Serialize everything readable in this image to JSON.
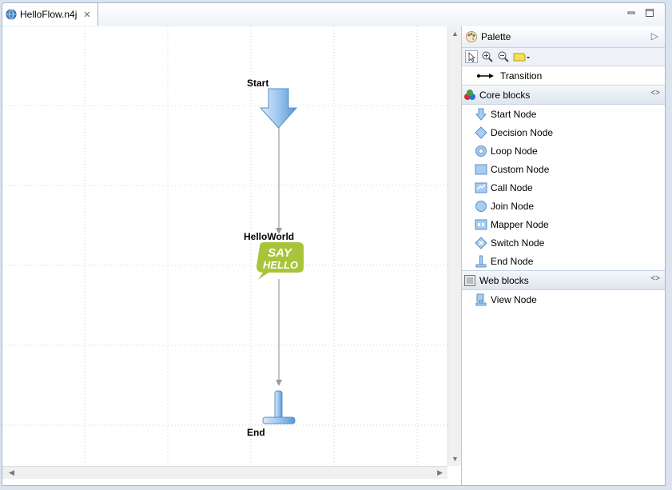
{
  "editor": {
    "tab_title": "HelloFlow.n4j",
    "tab_close_icon": "close-icon",
    "minimize_icon": "minimize-icon",
    "maximize_icon": "maximize-icon"
  },
  "flow": {
    "start_label": "Start",
    "hello_label": "HelloWorld",
    "end_label": "End",
    "say_hello_text": [
      "SAY",
      "HELLO"
    ]
  },
  "palette": {
    "title": "Palette",
    "transition_label": "Transition",
    "core_drawer_label": "Core blocks",
    "core_items": [
      {
        "label": "Start Node",
        "icon": "start-node-icon"
      },
      {
        "label": "Decision Node",
        "icon": "decision-node-icon"
      },
      {
        "label": "Loop Node",
        "icon": "loop-node-icon"
      },
      {
        "label": "Custom Node",
        "icon": "custom-node-icon"
      },
      {
        "label": "Call Node",
        "icon": "call-node-icon"
      },
      {
        "label": "Join Node",
        "icon": "join-node-icon"
      },
      {
        "label": "Mapper Node",
        "icon": "mapper-node-icon"
      },
      {
        "label": "Switch Node",
        "icon": "switch-node-icon"
      },
      {
        "label": "End Node",
        "icon": "end-node-icon"
      }
    ],
    "web_drawer_label": "Web blocks",
    "web_items": [
      {
        "label": "View Node",
        "icon": "view-node-icon"
      }
    ]
  },
  "colors": {
    "say_hello_green": "#a7c43a",
    "node_blue": "#6aa6dd",
    "connector_gray": "#9a9a9a"
  }
}
